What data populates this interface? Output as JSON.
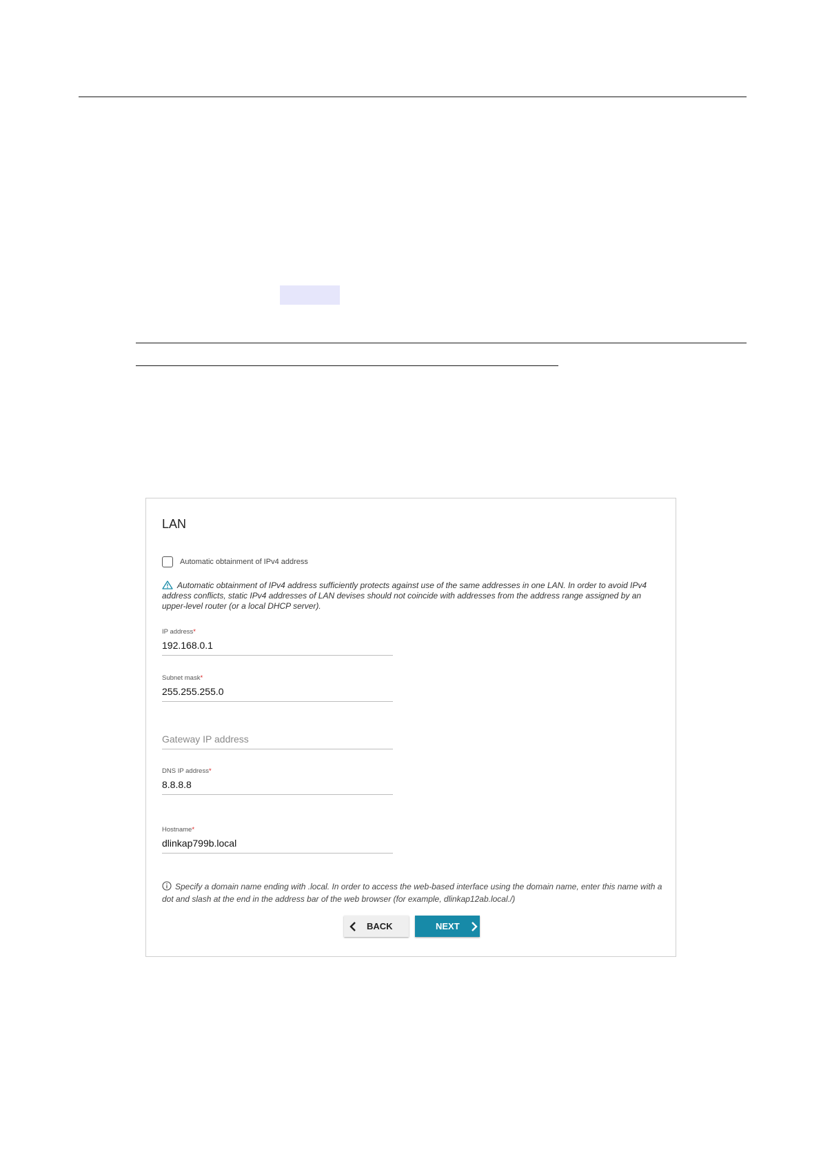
{
  "panel": {
    "title": "LAN",
    "auto_ipv4": {
      "label": "Automatic obtainment of IPv4 address",
      "checked": false
    },
    "warning": "Automatic obtainment of IPv4 address sufficiently protects against use of the same addresses in one LAN. In order to avoid IPv4 address conflicts, static IPv4 addresses of LAN devises should not coincide with addresses from the address range assigned by an upper-level router (or a local DHCP server).",
    "fields": {
      "ip_address": {
        "label": "IP address",
        "required": "*",
        "value": "192.168.0.1"
      },
      "subnet_mask": {
        "label": "Subnet mask",
        "required": "*",
        "value": "255.255.255.0"
      },
      "gateway": {
        "placeholder": "Gateway IP address",
        "value": ""
      },
      "dns": {
        "label": "DNS IP address",
        "required": "*",
        "value": "8.8.8.8"
      },
      "hostname": {
        "label": "Hostname",
        "required": "*",
        "value": "dlinkap799b.local"
      }
    },
    "info": "Specify a domain name ending with .local. In order to access the web-based interface using the domain name, enter this name with a dot and slash at the end in the address bar of the web browser (for example, dlinkap12ab.local./)",
    "buttons": {
      "back": "BACK",
      "next": "NEXT"
    }
  },
  "colors": {
    "accent": "#178aa8",
    "required": "#d92020",
    "warning_icon": "#178aa8",
    "highlight": "#e6e6fb"
  }
}
